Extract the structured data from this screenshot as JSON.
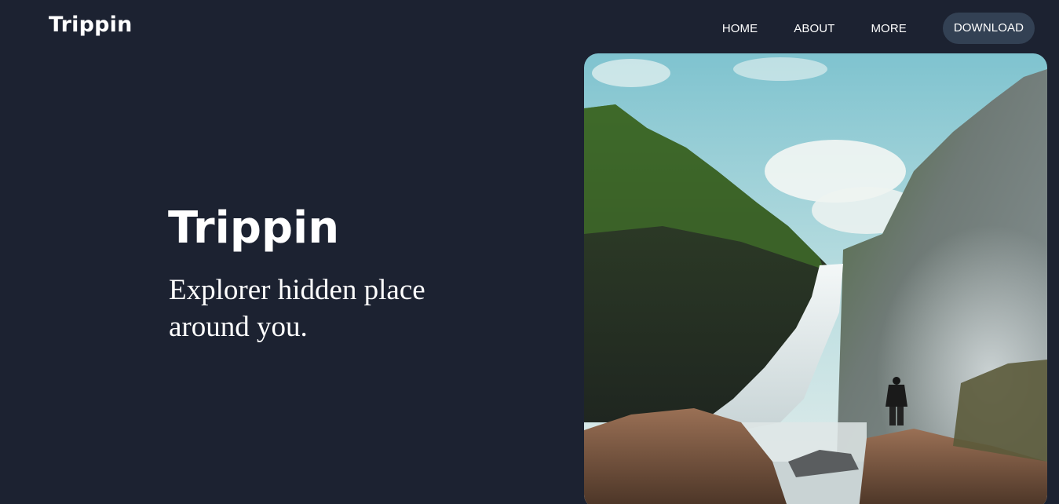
{
  "header": {
    "logo": "Trippin",
    "nav": {
      "home": "HOME",
      "about": "ABOUT",
      "more": "MORE",
      "download": "DOWNLOAD"
    }
  },
  "hero": {
    "title": "Trippin",
    "subtitle": "Explorer hidden place around you.",
    "image": "waterfall-photo"
  },
  "colors": {
    "background": "#1c2231",
    "download_button": "#334154",
    "text": "#ffffff"
  }
}
